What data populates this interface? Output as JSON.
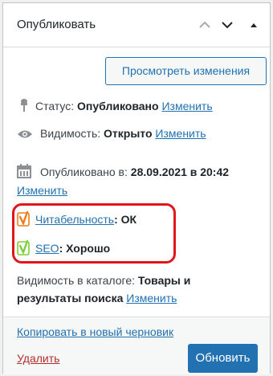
{
  "header": {
    "title": "Опубликовать",
    "controls": [
      "chevron-up-icon",
      "chevron-down-icon",
      "triangle-up-icon"
    ]
  },
  "preview_button": "Просмотреть изменения",
  "status": {
    "label": "Статус:",
    "value": "Опубликовано",
    "edit": "Изменить"
  },
  "visibility": {
    "label": "Видимость:",
    "value": "Открыто",
    "edit": "Изменить"
  },
  "published": {
    "label": "Опубликовано в:",
    "value": "28.09.2021 в 20:42",
    "edit": "Изменить"
  },
  "readability": {
    "link": "Читабельность",
    "value": ": ОК",
    "color": "#ee7c1b"
  },
  "seo": {
    "link": "SEO",
    "value": ": Хорошо",
    "color": "#7ad03a"
  },
  "catalog": {
    "label": "Видимость в каталоге:",
    "value_line1": "Товары и",
    "value_line2": "результаты поиска",
    "edit": "Изменить"
  },
  "footer": {
    "copy_link": "Копировать в новый черновик",
    "delete_link": "Удалить",
    "update_button": "Обновить"
  },
  "colors": {
    "accent": "#2271b1",
    "highlight": "#e0161b",
    "delete": "#b32d2e"
  }
}
